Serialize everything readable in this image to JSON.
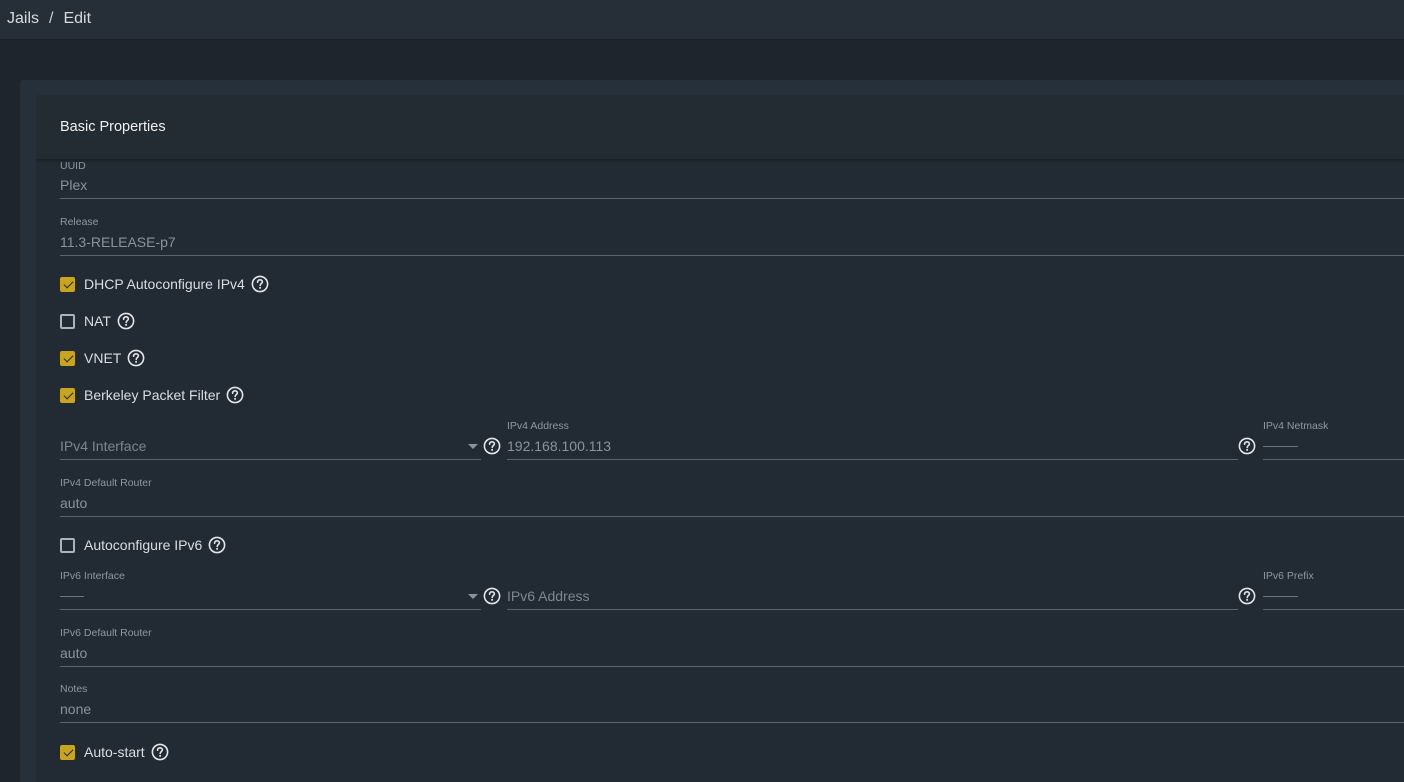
{
  "breadcrumb": {
    "parent": "Jails",
    "separator": "/",
    "current": "Edit"
  },
  "card": {
    "title": "Basic Properties"
  },
  "uuid": {
    "label": "UUID",
    "value": "Plex"
  },
  "release": {
    "label": "Release",
    "value": "11.3-RELEASE-p7"
  },
  "checkboxes": {
    "dhcp": {
      "label": "DHCP Autoconfigure IPv4",
      "checked": true
    },
    "nat": {
      "label": "NAT",
      "checked": false
    },
    "vnet": {
      "label": "VNET",
      "checked": true
    },
    "bpf": {
      "label": "Berkeley Packet Filter",
      "checked": true
    },
    "autoconf_ipv6": {
      "label": "Autoconfigure IPv6",
      "checked": false
    },
    "autostart": {
      "label": "Auto-start",
      "checked": true
    }
  },
  "ipv4": {
    "interface_placeholder": "IPv4 Interface",
    "address_label": "IPv4 Address",
    "address_value": "192.168.100.113",
    "netmask_label": "IPv4 Netmask",
    "default_router_label": "IPv4 Default Router",
    "default_router_value": "auto"
  },
  "ipv6": {
    "interface_label": "IPv6 Interface",
    "address_placeholder": "IPv6 Address",
    "prefix_label": "IPv6 Prefix",
    "default_router_label": "IPv6 Default Router",
    "default_router_value": "auto"
  },
  "notes": {
    "label": "Notes",
    "value": "none"
  },
  "icons": {
    "help": "help-circle-icon",
    "dropdown": "dropdown-caret-icon"
  },
  "colors": {
    "checkbox_checked": "#c7a422",
    "background": "#1e252c",
    "card": "#222a33"
  }
}
